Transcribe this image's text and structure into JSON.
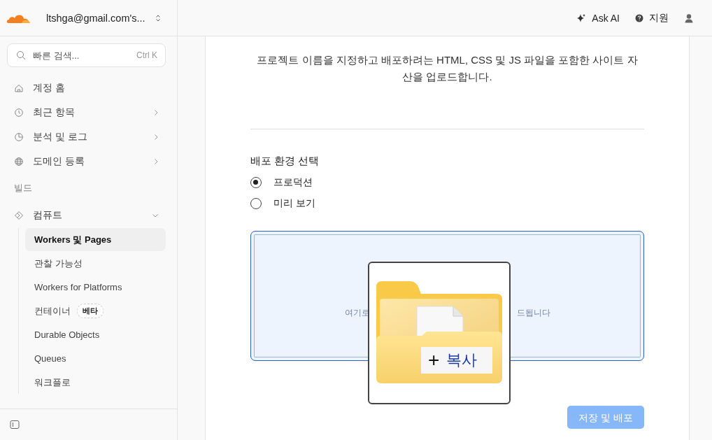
{
  "account": {
    "name": "ltshga@gmail.com's..."
  },
  "search": {
    "placeholder": "빠른 검색...",
    "shortcut": "Ctrl K"
  },
  "topbar": {
    "items": [
      {
        "kind": "ai",
        "label": "Ask AI"
      },
      {
        "kind": "help",
        "label": "지원"
      },
      {
        "kind": "user"
      }
    ]
  },
  "sidebar": {
    "items": [
      {
        "kind": "home",
        "label": "계정 홈",
        "has_submenu": false
      },
      {
        "kind": "clock",
        "label": "최근 항목",
        "has_submenu": true
      },
      {
        "kind": "chart",
        "label": "분석 및 로그",
        "has_submenu": true
      },
      {
        "kind": "globe",
        "label": "도메인 등록",
        "has_submenu": true
      }
    ],
    "section": "빌드",
    "group": {
      "kind": "compute",
      "label": "컴퓨트",
      "expanded": true,
      "children": [
        {
          "label": "Workers 및 Pages",
          "selected": true
        },
        {
          "label": "관찰 가능성",
          "selected": false
        },
        {
          "label": "Workers for Platforms",
          "selected": false
        },
        {
          "label": "컨테이너",
          "badge": "베타",
          "selected": false
        },
        {
          "label": "Durable Objects",
          "selected": false
        },
        {
          "label": "Queues",
          "selected": false
        },
        {
          "label": "워크플로",
          "selected": false
        }
      ]
    }
  },
  "main": {
    "description": "프로젝트 이름을 지정하고 배포하려는 HTML, CSS 및 JS 파일을 포함한 사이트 자산을 업로드합니다.",
    "environment": {
      "label": "배포 환경 선택",
      "options": [
        {
          "label": "프로덕션",
          "selected": true
        },
        {
          "label": "미리 보기",
          "selected": false
        }
      ]
    },
    "dropzone": {
      "hint_left": "여기로",
      "hint_right": "드됩니다",
      "active": true
    },
    "drag_overlay": {
      "label": "복사",
      "icon": "+"
    },
    "button": {
      "label": "저장 및 배포",
      "disabled": true
    }
  }
}
